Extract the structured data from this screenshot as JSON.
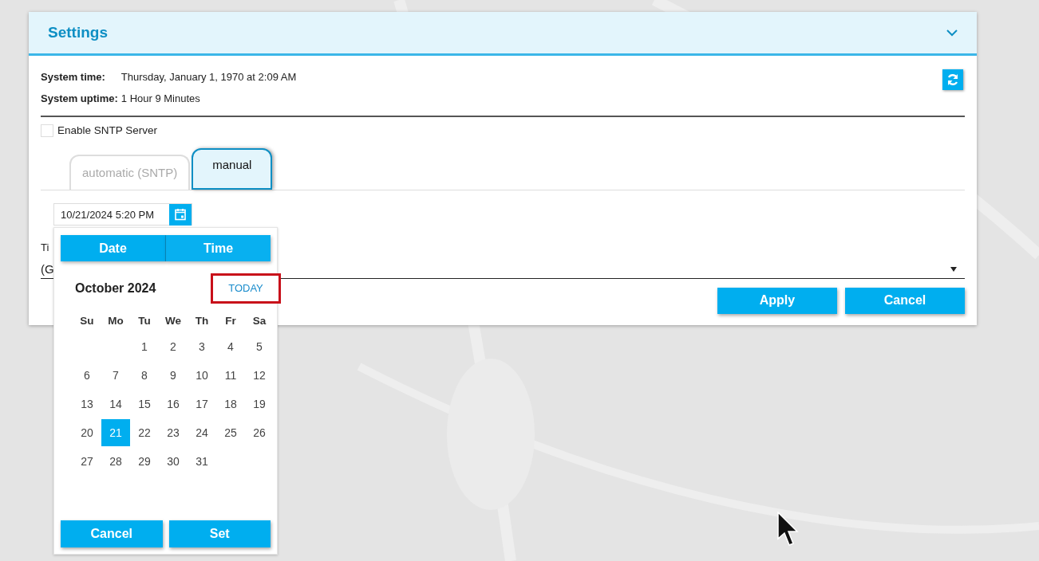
{
  "panel": {
    "title": "Settings",
    "expanded": true
  },
  "system": [
    {
      "label": "System time:",
      "value": "Thursday, January 1, 1970 at 2:09 AM"
    },
    {
      "label": "System uptime:",
      "value": "1 Hour 9 Minutes"
    }
  ],
  "sntp_checkbox": {
    "label": "Enable SNTP Server",
    "checked": false
  },
  "tabs": [
    {
      "label": "automatic (SNTP)",
      "selected": false
    },
    {
      "label": "manual",
      "selected": true
    }
  ],
  "datetime_field": {
    "value": "10/21/2024 5:20 PM"
  },
  "timezone": {
    "label": "Ti",
    "value": "(G"
  },
  "buttons": [
    "Apply",
    "Cancel"
  ],
  "picker": {
    "tabs": [
      {
        "label": "Date",
        "selected": true
      },
      {
        "label": "Time",
        "selected": false
      }
    ],
    "month": "October 2024",
    "today": {
      "label": "TODAY",
      "highlighted": true
    },
    "weekdays": [
      "Su",
      "Mo",
      "Tu",
      "We",
      "Th",
      "Fr",
      "Sa"
    ],
    "weeks": [
      [
        {
          "day": "1",
          "selected": false
        },
        {
          "day": "2",
          "selected": false
        },
        {
          "day": "3",
          "selected": false
        },
        {
          "day": "4",
          "selected": false
        },
        {
          "day": "5",
          "selected": false
        }
      ],
      [
        {
          "day": "6",
          "selected": false
        },
        {
          "day": "7",
          "selected": false
        },
        {
          "day": "8",
          "selected": false
        },
        {
          "day": "9",
          "selected": false
        },
        {
          "day": "10",
          "selected": false
        },
        {
          "day": "11",
          "selected": false
        },
        {
          "day": "12",
          "selected": false
        }
      ],
      [
        {
          "day": "13",
          "selected": false
        },
        {
          "day": "14",
          "selected": false
        },
        {
          "day": "15",
          "selected": false
        },
        {
          "day": "16",
          "selected": false
        },
        {
          "day": "17",
          "selected": false
        },
        {
          "day": "18",
          "selected": false
        },
        {
          "day": "19",
          "selected": false
        }
      ],
      [
        {
          "day": "20",
          "selected": false
        },
        {
          "day": "21",
          "selected": true
        },
        {
          "day": "22",
          "selected": false
        },
        {
          "day": "23",
          "selected": false
        },
        {
          "day": "24",
          "selected": false
        },
        {
          "day": "25",
          "selected": false
        },
        {
          "day": "26",
          "selected": false
        }
      ],
      [
        {
          "day": "27",
          "selected": false
        },
        {
          "day": "28",
          "selected": false
        },
        {
          "day": "29",
          "selected": false
        },
        {
          "day": "30",
          "selected": false
        },
        {
          "day": "31",
          "selected": false
        }
      ]
    ],
    "buttons": [
      "Cancel",
      "Set"
    ]
  }
}
